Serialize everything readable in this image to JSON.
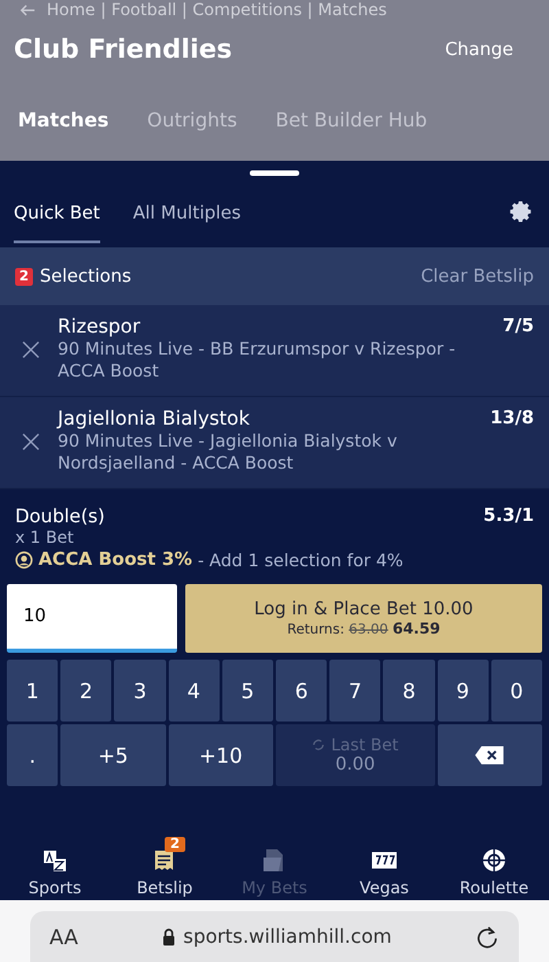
{
  "header": {
    "breadcrumb": "Home | Football | Competitions | Matches",
    "title": "Club Friendlies",
    "change": "Change",
    "tabs": [
      {
        "label": "Matches",
        "selected": true
      },
      {
        "label": "Outrights",
        "selected": false
      },
      {
        "label": "Bet Builder Hub",
        "selected": false
      }
    ]
  },
  "betslip": {
    "tabs": [
      {
        "label": "Quick Bet",
        "selected": true
      },
      {
        "label": "All Multiples",
        "selected": false
      }
    ],
    "count": "2",
    "selections_label": "Selections",
    "clear": "Clear Betslip",
    "selections": [
      {
        "name": "Rizespor",
        "odds": "7/5",
        "market": "90 Minutes Live - BB Erzurumspor v Rizespor - ACCA Boost"
      },
      {
        "name": "Jagiellonia Bialystok",
        "odds": "13/8",
        "market": "90 Minutes Live - Jagiellonia Bialystok v Nordsjaelland - ACCA Boost"
      }
    ],
    "multiple": {
      "type": "Double(s)",
      "odds": "5.3/1",
      "bets": "x 1 Bet",
      "boost": "ACCA Boost 3%",
      "boost_note": "- Add 1 selection for 4%"
    },
    "stake": {
      "value": "10"
    },
    "place": {
      "label": "Log in & Place Bet 10.00",
      "returns_label": "Returns:",
      "old_returns": "63.00",
      "new_returns": "64.59"
    },
    "keypad": [
      {
        "kind": "digit",
        "label": "1",
        "disabled": false
      },
      {
        "kind": "digit",
        "label": "2",
        "disabled": false
      },
      {
        "kind": "digit",
        "label": "3",
        "disabled": false
      },
      {
        "kind": "digit",
        "label": "4",
        "disabled": false
      },
      {
        "kind": "digit",
        "label": "5",
        "disabled": false
      },
      {
        "kind": "digit",
        "label": "6",
        "disabled": false
      },
      {
        "kind": "digit",
        "label": "7",
        "disabled": false
      },
      {
        "kind": "digit",
        "label": "8",
        "disabled": false
      },
      {
        "kind": "digit",
        "label": "9",
        "disabled": false
      },
      {
        "kind": "digit",
        "label": "0",
        "disabled": false
      },
      {
        "kind": "digit",
        "label": ".",
        "disabled": false
      },
      {
        "kind": "add",
        "label": "+5",
        "disabled": false
      },
      {
        "kind": "add",
        "label": "+10",
        "disabled": false
      },
      {
        "kind": "last",
        "label": "Last Bet",
        "value": "0.00",
        "disabled": true
      },
      {
        "kind": "backspace",
        "disabled": false
      }
    ]
  },
  "nav": [
    {
      "kind": "sports",
      "label": "Sports",
      "disabled": false
    },
    {
      "kind": "betslip",
      "label": "Betslip",
      "badge": "2",
      "disabled": false
    },
    {
      "kind": "mybets",
      "label": "My Bets",
      "disabled": true
    },
    {
      "kind": "vegas",
      "label": "Vegas",
      "disabled": false
    },
    {
      "kind": "roulette",
      "label": "Roulette",
      "disabled": false
    }
  ],
  "browser": {
    "text_size": "AA",
    "url": "sports.williamhill.com"
  }
}
